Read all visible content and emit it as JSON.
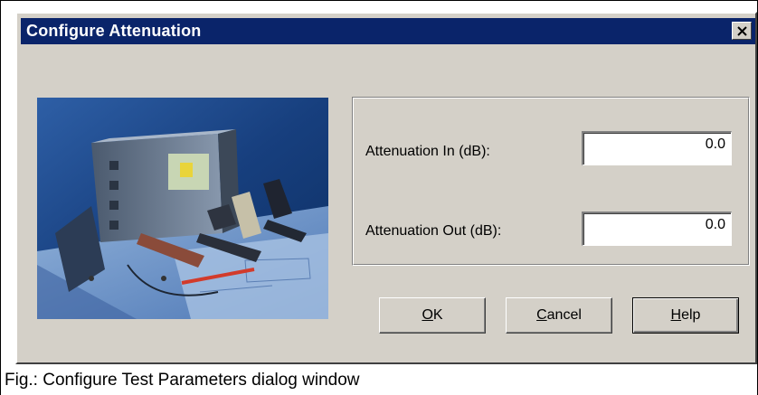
{
  "dialog": {
    "title": "Configure Attenuation",
    "close_glyph": "✕",
    "image": {
      "name": "test-equipment-with-mobile-phones-photo"
    }
  },
  "fields": {
    "attenuation_in": {
      "label": "Attenuation In (dB):",
      "value": "0.0"
    },
    "attenuation_out": {
      "label": "Attenuation Out (dB):",
      "value": "0.0"
    }
  },
  "buttons": {
    "ok": {
      "mnemonic": "O",
      "rest": "K"
    },
    "cancel": {
      "mnemonic": "C",
      "rest": "ancel"
    },
    "help": {
      "mnemonic": "H",
      "rest": "elp"
    }
  },
  "caption": "Fig.: Configure Test Parameters dialog window",
  "colors": {
    "titlebar": "#0a246a",
    "dialog_face": "#d4d0c8",
    "title_text": "#ffffff"
  }
}
